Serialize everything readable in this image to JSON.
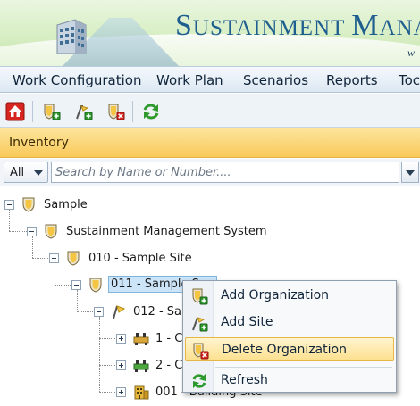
{
  "banner": {
    "title_cap1": "S",
    "title_rest1": "USTAINMENT ",
    "title_cap2": "M",
    "title_rest2": "ANAGEM",
    "subtitle": "w"
  },
  "menu": {
    "work_configuration": "Work Configuration",
    "work_plan": "Work Plan",
    "scenarios": "Scenarios",
    "reports": "Reports",
    "tools": "Toc"
  },
  "inventory": {
    "header": "Inventory",
    "filter_value": "All",
    "search_placeholder": "Search by Name or Number...."
  },
  "tree": {
    "nodes": [
      {
        "label": "Sample"
      },
      {
        "label": "Sustainment Management System"
      },
      {
        "label": "010 - Sample Site"
      },
      {
        "label": "011 - Sample S"
      },
      {
        "label": "012 - Sa"
      },
      {
        "label": "1 - C"
      },
      {
        "label": "2 - C"
      },
      {
        "label": "001 - Building Site"
      }
    ]
  },
  "context_menu": {
    "items": [
      {
        "label": "Add Organization",
        "icon": "add-organization-icon"
      },
      {
        "label": "Add Site",
        "icon": "add-site-icon"
      },
      {
        "label": "Delete Organization",
        "icon": "delete-organization-icon"
      },
      {
        "label": "Refresh",
        "icon": "refresh-icon"
      }
    ]
  },
  "colors": {
    "inventory_header": "#f9c95a",
    "selection": "#cce4f7",
    "menu_hover": "#fde08f",
    "brand": "#1f5f8f"
  }
}
